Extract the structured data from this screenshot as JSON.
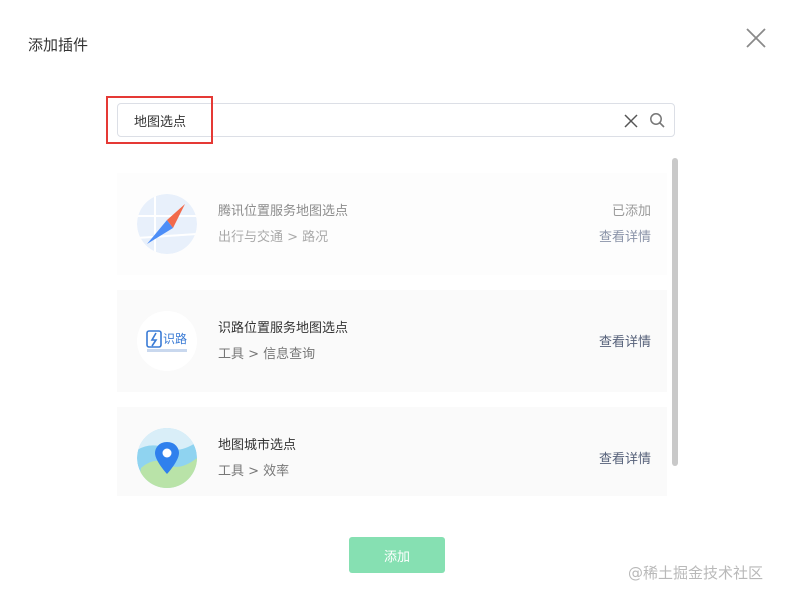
{
  "dialog": {
    "title": "添加插件"
  },
  "search": {
    "value": "地图选点"
  },
  "plugins": [
    {
      "name": "腾讯位置服务地图选点",
      "category": "出行与交通 > 路况",
      "status": "已添加",
      "detail_label": "查看详情"
    },
    {
      "name": "识路位置服务地图选点",
      "category": "工具 > 信息查询",
      "detail_label": "查看详情",
      "logo_text": "识路"
    },
    {
      "name": "地图城市选点",
      "category": "工具 > 效率",
      "detail_label": "查看详情"
    }
  ],
  "footer": {
    "add_label": "添加"
  },
  "watermark": "@稀土掘金技术社区",
  "colors": {
    "accent": "#86e0b2",
    "highlight": "#e53935",
    "link": "#56617a"
  }
}
